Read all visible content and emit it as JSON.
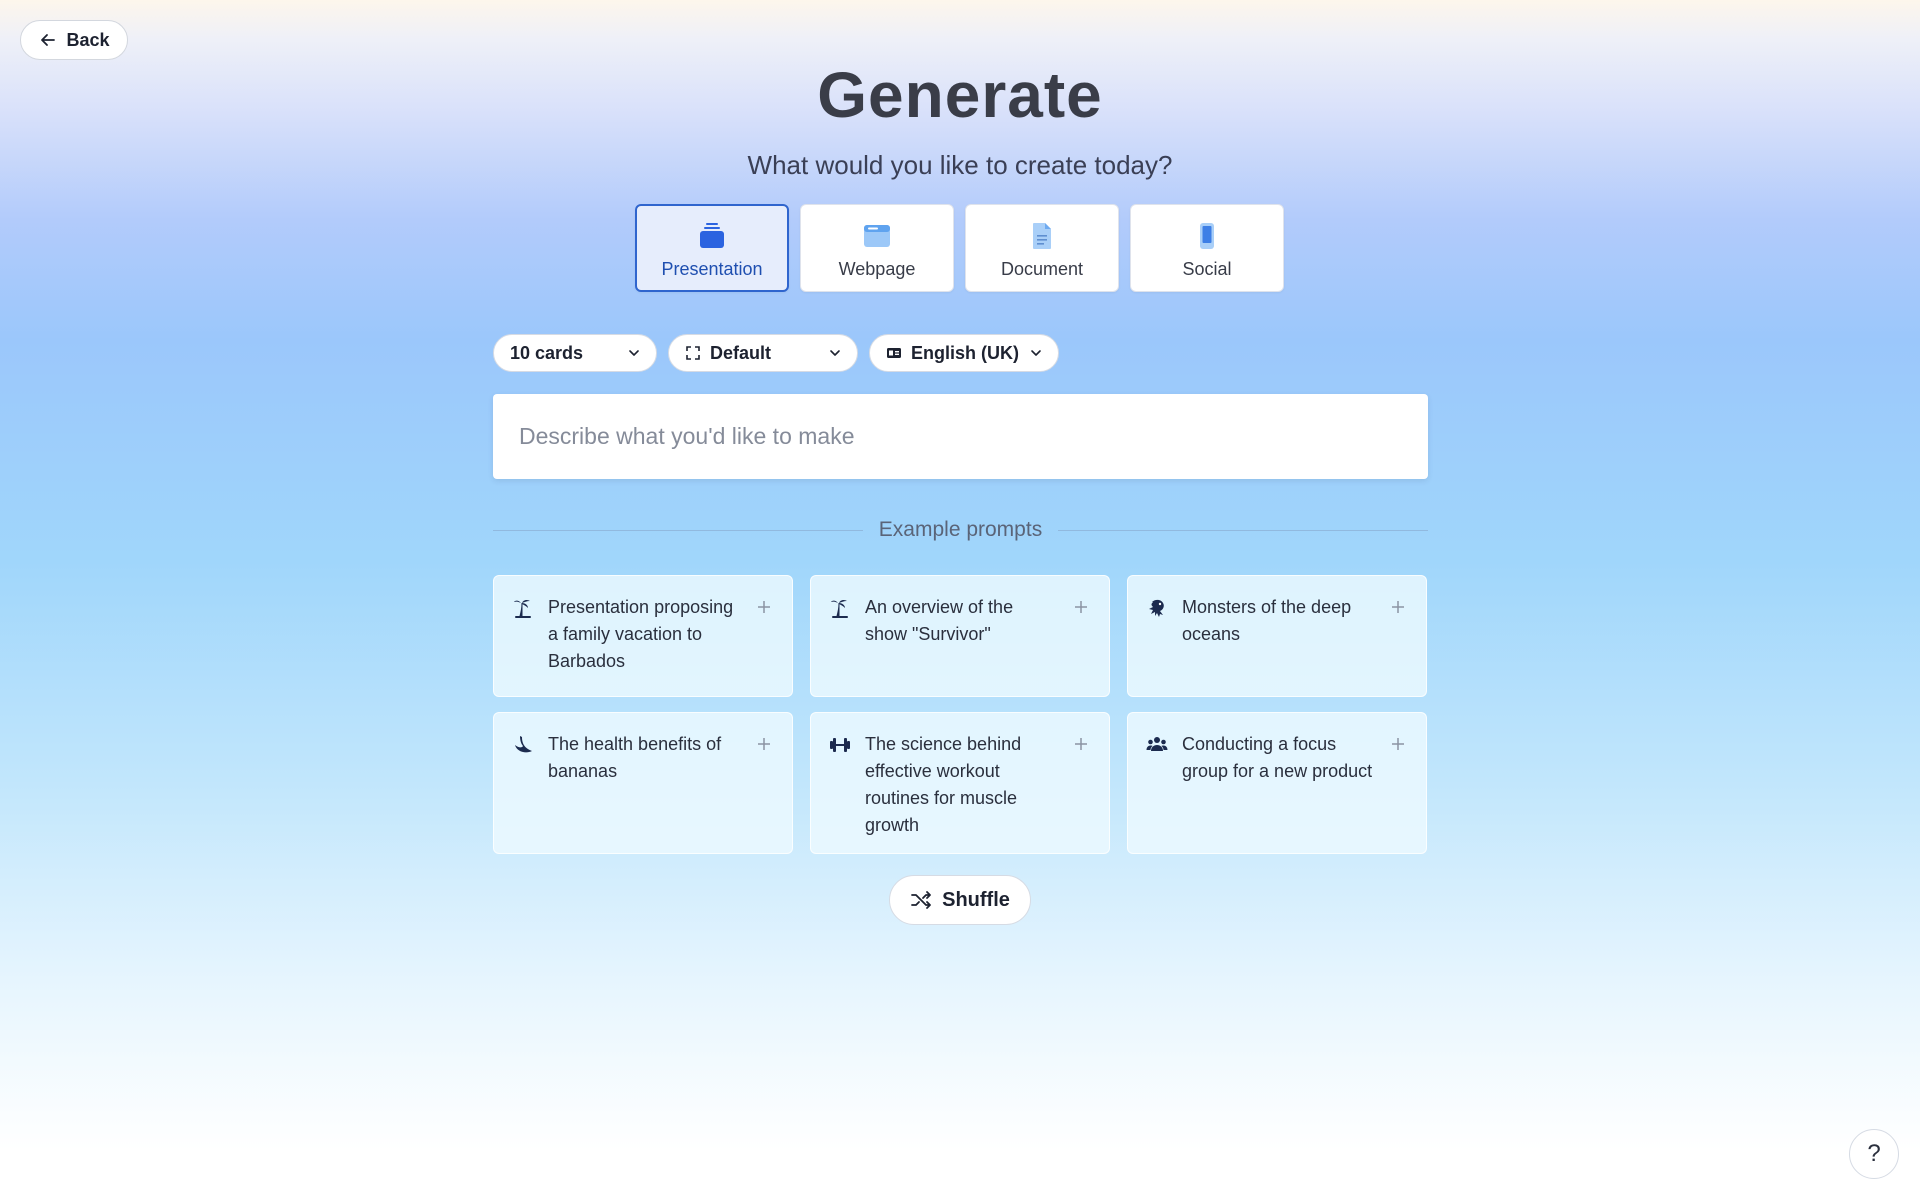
{
  "back": {
    "label": "Back",
    "icon": "arrow-left-icon"
  },
  "header": {
    "title": "Generate",
    "subtitle": "What would you like to create today?"
  },
  "types": [
    {
      "label": "Presentation",
      "icon": "presentation-icon",
      "selected": true
    },
    {
      "label": "Webpage",
      "icon": "webpage-icon",
      "selected": false
    },
    {
      "label": "Document",
      "icon": "document-icon",
      "selected": false
    },
    {
      "label": "Social",
      "icon": "phone-icon",
      "selected": false
    }
  ],
  "options": {
    "cards": {
      "value": "10 cards",
      "icon": "chevron-down-icon"
    },
    "format": {
      "value": "Default",
      "icon": "frame-icon"
    },
    "language": {
      "value": "English (UK)",
      "icon": "language-icon"
    }
  },
  "prompt": {
    "placeholder": "Describe what you'd like to make",
    "value": ""
  },
  "examples": {
    "heading": "Example prompts",
    "items": [
      {
        "text": "Presentation proposing a family vacation to Barbados",
        "icon": "island-icon"
      },
      {
        "text": "An overview of the show \"Survivor\"",
        "icon": "island-icon"
      },
      {
        "text": "Monsters of the deep oceans",
        "icon": "sea-monster-icon"
      },
      {
        "text": "The health benefits of bananas",
        "icon": "banana-icon"
      },
      {
        "text": "The science behind effective workout routines for muscle growth",
        "icon": "dumbbell-icon"
      },
      {
        "text": "Conducting a focus group for a new product",
        "icon": "group-icon"
      }
    ]
  },
  "shuffle": {
    "label": "Shuffle",
    "icon": "shuffle-icon"
  },
  "help": {
    "label": "?"
  },
  "colors": {
    "accent": "#2f65ce",
    "selected_bg": "#e6edfc",
    "icon_dark": "#1c2b4f",
    "icon_blue": "#2b63e0"
  }
}
